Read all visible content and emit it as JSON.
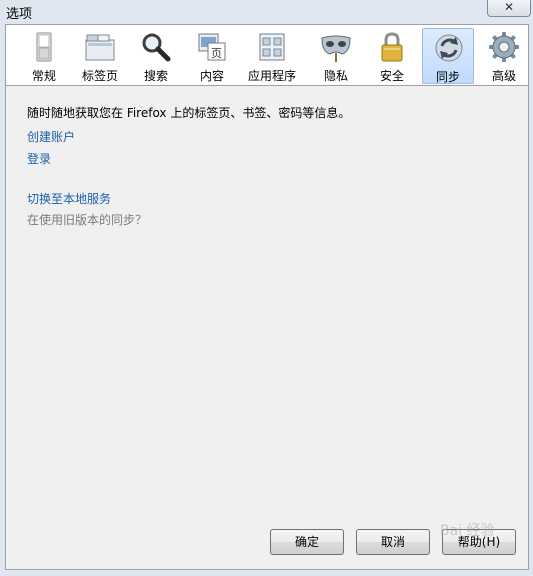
{
  "window": {
    "title": "选项",
    "close_glyph": "✕"
  },
  "toolbar": {
    "panes": [
      {
        "label": "常规",
        "icon": "general-switch-icon"
      },
      {
        "label": "标签页",
        "icon": "tabs-icon"
      },
      {
        "label": "搜索",
        "icon": "magnifier-icon"
      },
      {
        "label": "内容",
        "icon": "content-page-icon"
      },
      {
        "label": "应用程序",
        "icon": "applications-icon"
      },
      {
        "label": "隐私",
        "icon": "privacy-mask-icon"
      },
      {
        "label": "安全",
        "icon": "padlock-icon"
      },
      {
        "label": "同步",
        "icon": "sync-arrows-icon",
        "selected": true
      },
      {
        "label": "高级",
        "icon": "gear-icon"
      }
    ],
    "selected_bg": "#c9dffb"
  },
  "sync": {
    "intro": "随时随地获取您在 Firefox 上的标签页、书签、密码等信息。",
    "create_account": "创建账户",
    "sign_in": "登录",
    "switch_local": "切换至本地服务",
    "old_sync_question": "在使用旧版本的同步？"
  },
  "buttons": {
    "ok": "确定",
    "cancel": "取消",
    "help": "帮助(H)"
  },
  "watermark": "Bai 经验",
  "colors": {
    "link": "#1e5fa8",
    "muted": "#7b7b7b"
  }
}
